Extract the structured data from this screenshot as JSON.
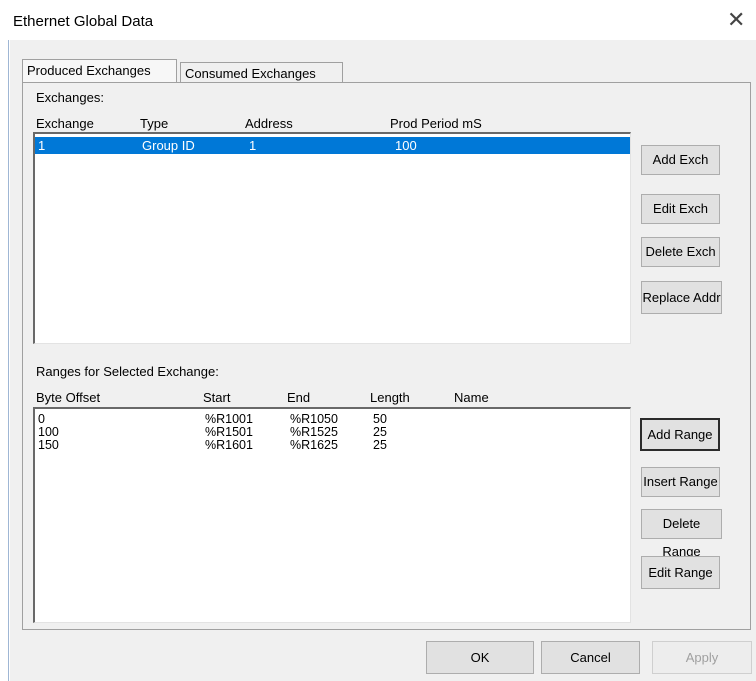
{
  "window": {
    "title": "Ethernet Global Data"
  },
  "tabs": [
    {
      "label": "Produced Exchanges",
      "active": true
    },
    {
      "label": "Consumed Exchanges",
      "active": false
    }
  ],
  "exchanges": {
    "label": "Exchanges:",
    "columns": [
      "Exchange",
      "Type",
      "Address",
      "Prod Period mS"
    ],
    "rows": [
      {
        "exchange": "1",
        "type": "Group ID",
        "address": "1",
        "period": "100",
        "selected": true
      }
    ]
  },
  "exchange_buttons": {
    "add": "Add Exch",
    "edit": "Edit Exch",
    "delete": "Delete Exch",
    "replace": "Replace Addr"
  },
  "ranges": {
    "label": "Ranges for Selected Exchange:",
    "columns": [
      "Byte Offset",
      "Start",
      "End",
      "Length",
      "Name"
    ],
    "rows": [
      {
        "offset": "0",
        "start": "%R1001",
        "end": "%R1050",
        "length": "50",
        "name": ""
      },
      {
        "offset": "100",
        "start": "%R1501",
        "end": "%R1525",
        "length": "25",
        "name": ""
      },
      {
        "offset": "150",
        "start": "%R1601",
        "end": "%R1625",
        "length": "25",
        "name": ""
      }
    ]
  },
  "range_buttons": {
    "add": "Add Range",
    "insert": "Insert Range",
    "delete": "Delete Range",
    "edit": "Edit Range"
  },
  "dialog_buttons": {
    "ok": "OK",
    "cancel": "Cancel",
    "apply": "Apply"
  },
  "colors": {
    "selection": "#0078d7",
    "dialog_bg": "#f0f0f0"
  },
  "icons": {
    "close": "close-icon"
  }
}
